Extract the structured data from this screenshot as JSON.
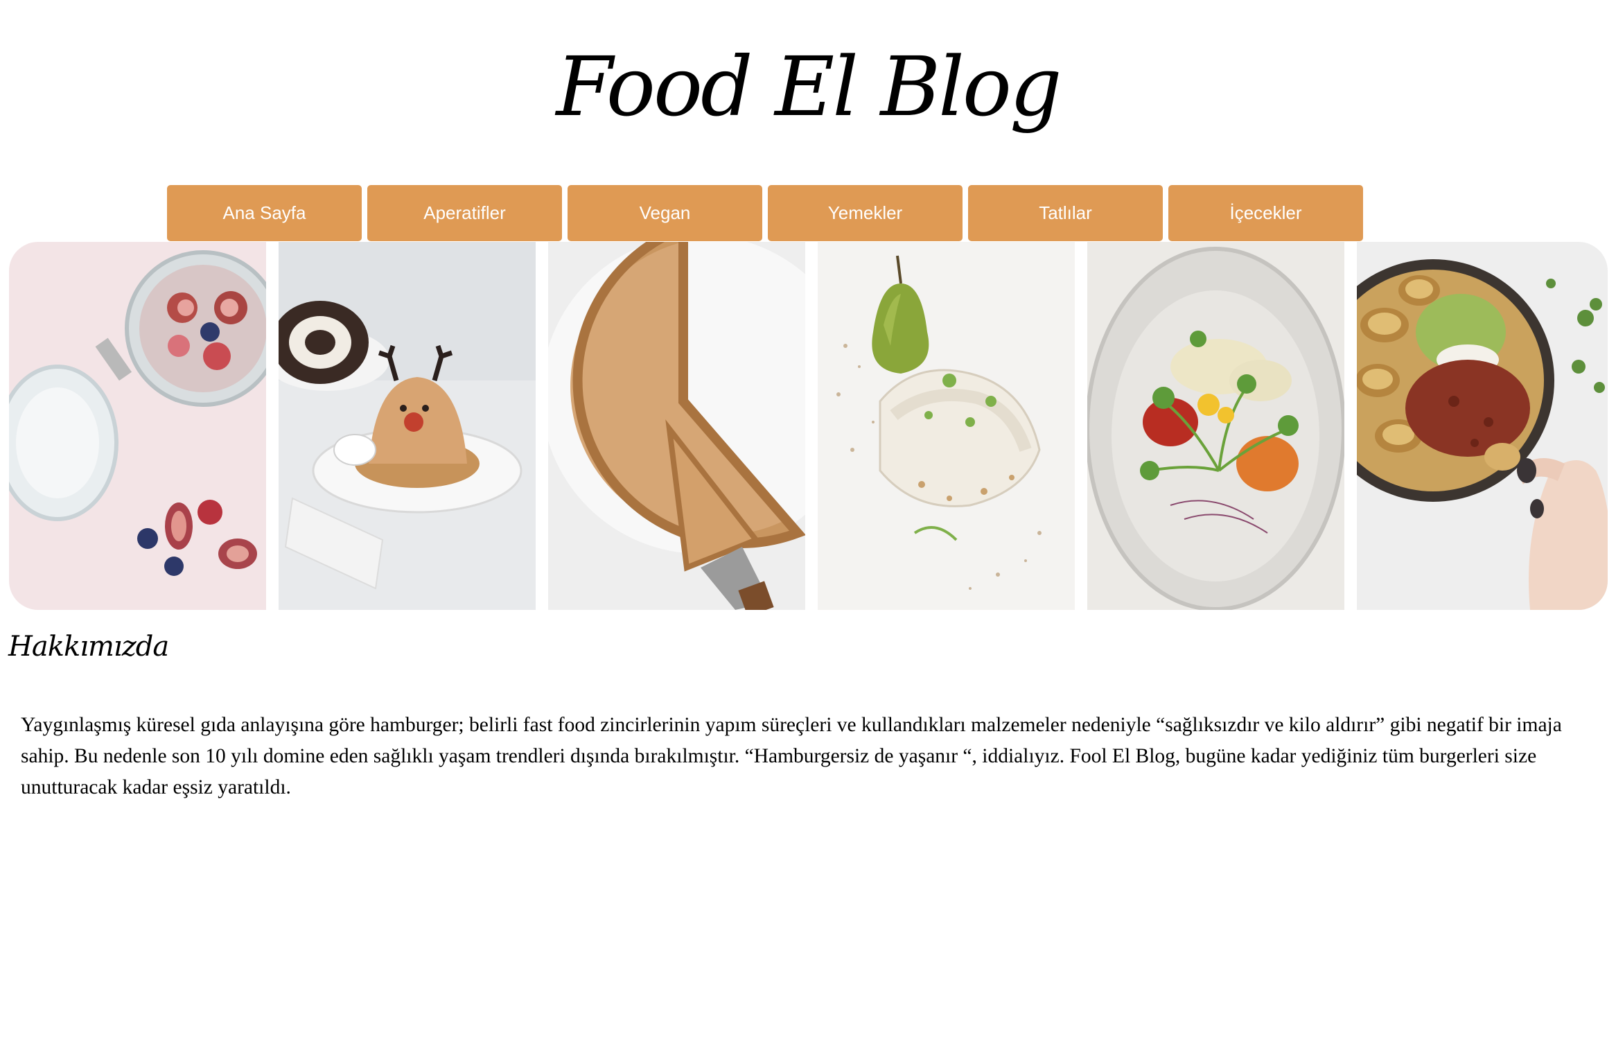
{
  "site": {
    "title": "Food El Blog"
  },
  "nav": {
    "items": [
      {
        "label": "Ana Sayfa"
      },
      {
        "label": "Aperatifler"
      },
      {
        "label": "Vegan"
      },
      {
        "label": "Yemekler"
      },
      {
        "label": "Tatlılar"
      },
      {
        "label": "İçecekler"
      }
    ],
    "button_color": "#df9a54",
    "text_color": "#ffffff"
  },
  "gallery": {
    "photos": [
      {
        "icon": "chia-pudding-figs-photo"
      },
      {
        "icon": "reindeer-dessert-photo"
      },
      {
        "icon": "pie-slice-photo"
      },
      {
        "icon": "pear-plate-photo"
      },
      {
        "icon": "salad-glass-photo"
      },
      {
        "icon": "potato-bowl-photo"
      }
    ]
  },
  "about": {
    "heading": "Hakkımızda",
    "text": "Yaygınlaşmış küresel gıda anlayışına göre hamburger; belirli fast food zincirlerinin yapım süreçleri ve kullandıkları malzemeler nedeniyle “sağlıksızdır ve kilo aldırır” gibi negatif bir imaja sahip. Bu nedenle son 10 yılı domine eden sağlıklı yaşam trendleri dışında bırakılmıştır. “Hamburgersiz de yaşanır “, iddialıyız. Fool El Blog, bugüne kadar yediğiniz tüm burgerleri size unutturacak kadar eşsiz yaratıldı."
  }
}
